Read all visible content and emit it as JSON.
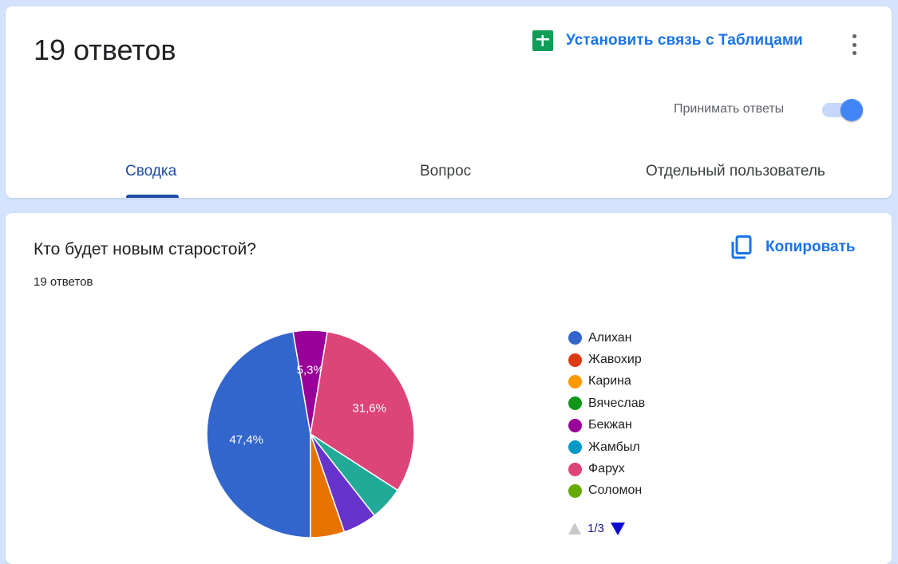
{
  "header": {
    "responses_title": "19 ответов",
    "sheets_link_label": "Установить связь с Таблицами",
    "accept_label": "Принимать ответы",
    "accept_on": true
  },
  "tabs": [
    {
      "label": "Сводка",
      "active": true
    },
    {
      "label": "Вопрос",
      "active": false
    },
    {
      "label": "Отдельный пользователь",
      "active": false
    }
  ],
  "question": {
    "title": "Кто будет новым старостой?",
    "count_label": "19 ответов",
    "copy_label": "Копировать"
  },
  "legend": {
    "items": [
      {
        "name": "Алихан",
        "color": "#3366cc"
      },
      {
        "name": "Жавохир",
        "color": "#dc3912"
      },
      {
        "name": "Карина",
        "color": "#ff9900"
      },
      {
        "name": "Вячеслав",
        "color": "#109618"
      },
      {
        "name": "Бекжан",
        "color": "#990099"
      },
      {
        "name": "Жамбыл",
        "color": "#0099c6"
      },
      {
        "name": "Фарух",
        "color": "#dd4477"
      },
      {
        "name": "Соломон",
        "color": "#66aa00"
      }
    ],
    "pager": "1/3"
  },
  "chart_data": {
    "type": "pie",
    "slices": [
      {
        "name": "Алихан",
        "value": 47.4,
        "label": "47,4%",
        "color": "#3366cc"
      },
      {
        "name": "Бекжан",
        "value": 5.3,
        "label": "5,3%",
        "color": "#990099"
      },
      {
        "name": "Фарух",
        "value": 31.6,
        "label": "31,6%",
        "color": "#dd4477"
      },
      {
        "value": 5.3,
        "label": "",
        "color": "#22aa99"
      },
      {
        "value": 5.3,
        "label": "",
        "color": "#6633cc"
      },
      {
        "value": 5.3,
        "label": "",
        "color": "#e67300"
      }
    ]
  }
}
